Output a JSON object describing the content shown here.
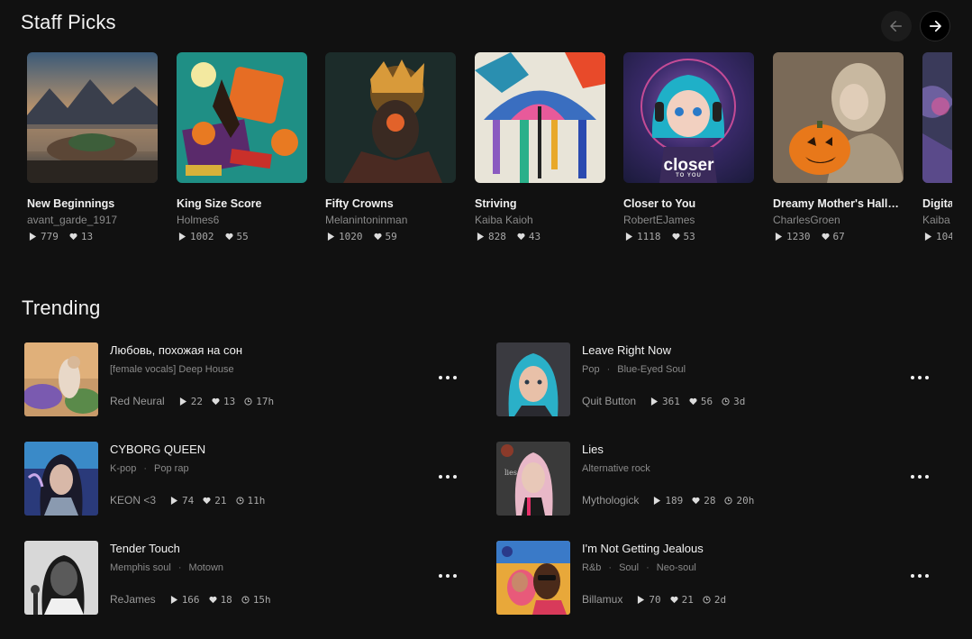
{
  "staff_picks": {
    "title": "Staff Picks",
    "prev_icon": "arrow-left-icon",
    "next_icon": "arrow-right-icon",
    "cards": [
      {
        "title": "New Beginnings",
        "artist": "avant_garde_1917",
        "plays": "779",
        "likes": "13"
      },
      {
        "title": "King Size Score",
        "artist": "Holmes6",
        "plays": "1002",
        "likes": "55"
      },
      {
        "title": "Fifty Crowns",
        "artist": "Melanintoninman",
        "plays": "1020",
        "likes": "59"
      },
      {
        "title": "Striving",
        "artist": "Kaiba Kaioh",
        "plays": "828",
        "likes": "43"
      },
      {
        "title": "Closer to You",
        "artist": "RobertEJames",
        "plays": "1118",
        "likes": "53",
        "art_text": "closer",
        "art_subtext": "TO YOU"
      },
      {
        "title": "Dreamy Mother's Hallo...",
        "artist": "CharlesGroen",
        "plays": "1230",
        "likes": "67"
      },
      {
        "title": "Digita",
        "artist": "Kaiba",
        "plays": "104",
        "likes": ""
      }
    ]
  },
  "trending": {
    "title": "Trending",
    "items": [
      {
        "title": "Любовь, похожая на сон",
        "tags": [
          "[female vocals] Deep House"
        ],
        "artist": "Red Neural",
        "plays": "22",
        "likes": "13",
        "age": "17h"
      },
      {
        "title": "Leave Right Now",
        "tags": [
          "Pop",
          "Blue-Eyed Soul"
        ],
        "artist": "Quit Button",
        "plays": "361",
        "likes": "56",
        "age": "3d"
      },
      {
        "title": "CYBORG QUEEN",
        "tags": [
          "K-pop",
          "Pop rap"
        ],
        "artist": "KEON <3",
        "plays": "74",
        "likes": "21",
        "age": "11h"
      },
      {
        "title": "Lies",
        "tags": [
          "Alternative rock"
        ],
        "artist": "Mythologick",
        "plays": "189",
        "likes": "28",
        "age": "20h",
        "art_text": "lies"
      },
      {
        "title": "Tender Touch",
        "tags": [
          "Memphis soul",
          "Motown"
        ],
        "artist": "ReJames",
        "plays": "166",
        "likes": "18",
        "age": "15h"
      },
      {
        "title": "I'm Not Getting Jealous",
        "tags": [
          "R&b",
          "Soul",
          "Neo-soul"
        ],
        "artist": "Billamux",
        "plays": "70",
        "likes": "21",
        "age": "2d"
      }
    ]
  },
  "icons": {
    "play": "play-icon",
    "like": "heart-icon",
    "age": "clock-icon",
    "more": "more-options-icon"
  }
}
